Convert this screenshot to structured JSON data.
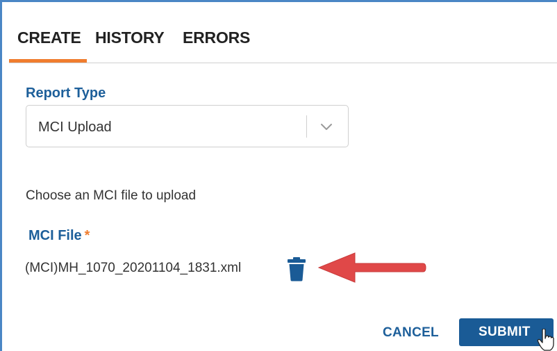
{
  "tabs": [
    {
      "label": "CREATE",
      "active": true
    },
    {
      "label": "HISTORY",
      "active": false
    },
    {
      "label": "ERRORS",
      "active": false
    }
  ],
  "form": {
    "report_type_label": "Report Type",
    "report_type_value": "MCI Upload",
    "instruction": "Choose an MCI file to upload",
    "mci_file_label": "MCI File",
    "required_marker": "*",
    "file_name": "(MCI)MH_1070_20201104_1831.xml"
  },
  "actions": {
    "cancel_label": "CANCEL",
    "submit_label": "SUBMIT"
  },
  "icons": {
    "select": "chevron-down-icon",
    "delete": "trash-icon",
    "annotation": "arrow-left-icon",
    "cursor": "hand-pointer-icon"
  },
  "colors": {
    "accent_blue": "#1d5f9a",
    "submit_bg": "#1a5b96",
    "tab_underline": "#f07d2e",
    "arrow_red": "#e04848",
    "frame_border": "#4a86c5"
  }
}
